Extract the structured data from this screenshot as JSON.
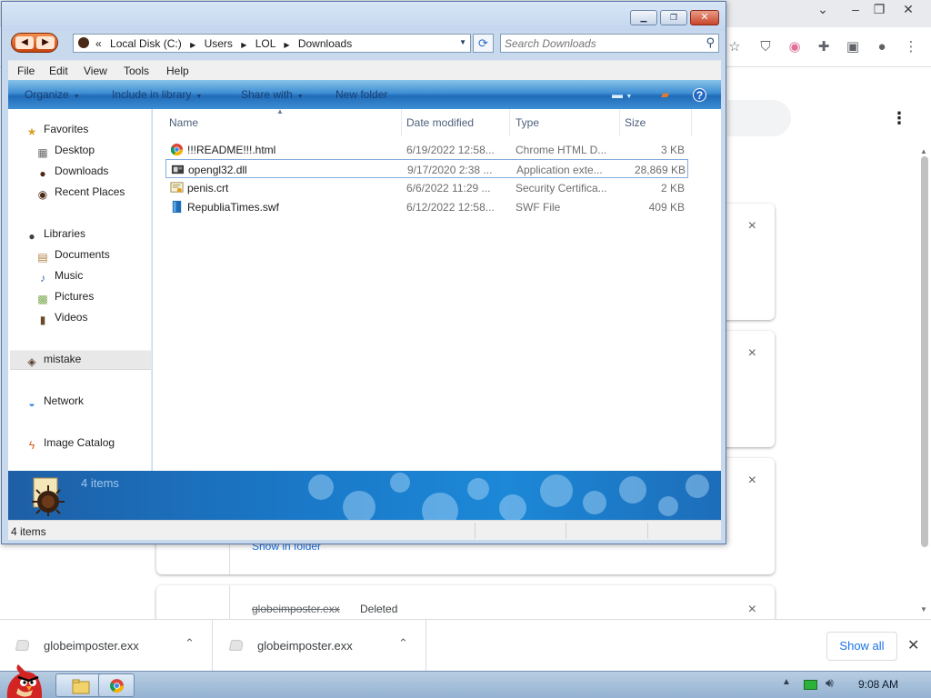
{
  "chrome": {
    "window_controls": [
      "⌄",
      "–",
      "❐",
      "✕"
    ],
    "extensions": [
      "ublock-icon",
      "ext-icon",
      "puzzle-icon",
      "sidepanel-icon",
      "profile-icon",
      "kebab-icon"
    ],
    "download_cards": [
      {
        "close": "×"
      },
      {
        "close": "×"
      },
      {
        "close": "×",
        "link": "Show in folder"
      },
      {
        "close": "×",
        "name": "globeimposter.exx",
        "state": "Deleted"
      }
    ],
    "download_bar": {
      "items": [
        {
          "name": "globeimposter.exx"
        },
        {
          "name": "globeimposter.exx"
        }
      ],
      "show_all": "Show all",
      "close": "✕"
    }
  },
  "explorer": {
    "caption_buttons": {
      "min": "▁",
      "max": "❐",
      "close": "✕"
    },
    "address": {
      "prefix": "«",
      "crumbs": [
        "Local Disk (C:)",
        "Users",
        "LOL",
        "Downloads"
      ]
    },
    "search": {
      "placeholder": "Search Downloads"
    },
    "menu": [
      "File",
      "Edit",
      "View",
      "Tools",
      "Help"
    ],
    "commands": [
      "Organize",
      "Include in library",
      "Share with",
      "New folder"
    ],
    "nav": {
      "favorites": "Favorites",
      "desktop": "Desktop",
      "downloads": "Downloads",
      "recent": "Recent Places",
      "libraries": "Libraries",
      "documents": "Documents",
      "music": "Music",
      "pictures": "Pictures",
      "videos": "Videos",
      "mistake": "mistake",
      "network": "Network",
      "catalog": "Image Catalog"
    },
    "columns": {
      "name": "Name",
      "date": "Date modified",
      "type": "Type",
      "size": "Size"
    },
    "files": [
      {
        "name": "!!!README!!!.html",
        "date": "6/19/2022 12:58...",
        "type": "Chrome HTML D...",
        "size": "3 KB",
        "icon": "chrome-icon"
      },
      {
        "name": "opengl32.dll",
        "date": "9/17/2020 2:38 ...",
        "type": "Application exte...",
        "size": "28,869 KB",
        "icon": "dll-icon"
      },
      {
        "name": "penis.crt",
        "date": "6/6/2022 11:29 ...",
        "type": "Security Certifica...",
        "size": "2 KB",
        "icon": "certificate-icon"
      },
      {
        "name": "RepubliaTimes.swf",
        "date": "6/12/2022 12:58...",
        "type": "SWF File",
        "size": "409 KB",
        "icon": "swf-icon"
      }
    ],
    "details_count": "4 items",
    "status_text": "4 items"
  },
  "taskbar": {
    "clock": "9:08 AM"
  },
  "colors": {
    "accent": "#1a73e8",
    "explorer_command_bar": "#3e8ed4",
    "details_pane": "#1a78c7"
  }
}
